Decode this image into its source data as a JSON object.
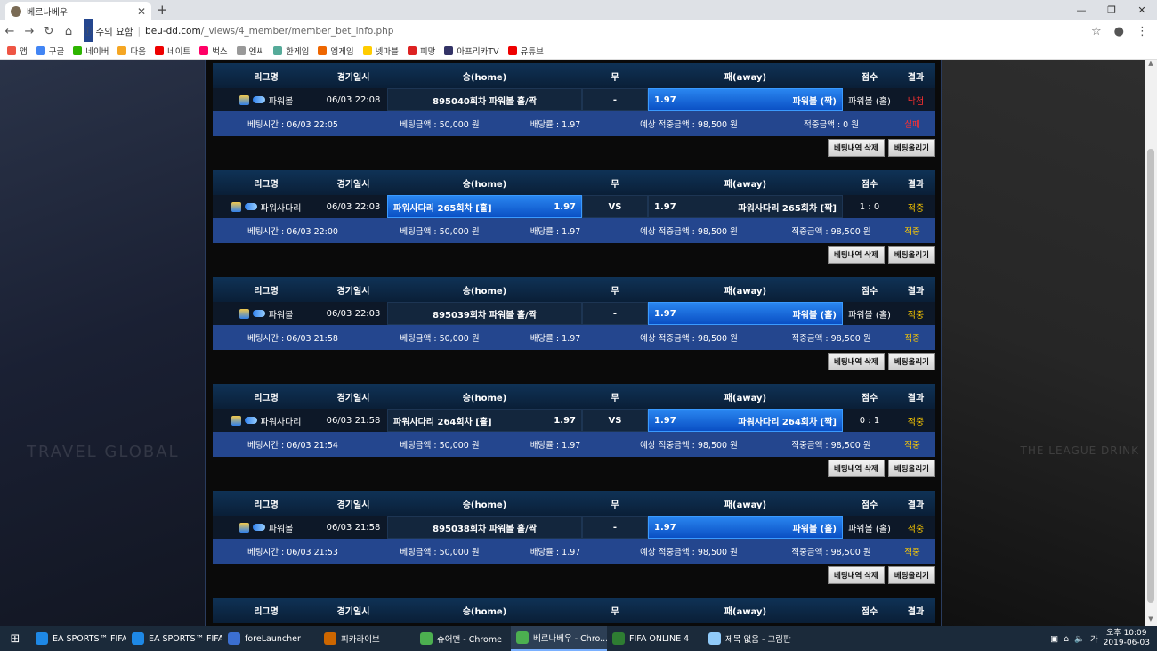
{
  "browser": {
    "tab_title": "베르나베우",
    "url_security": "주의 요함",
    "url_host": "beu-dd.com",
    "url_path": "/_views/4_member/member_bet_info.php"
  },
  "bookmarks": [
    {
      "label": "앱",
      "color": "#e54"
    },
    {
      "label": "구글",
      "color": "#4285f4"
    },
    {
      "label": "네이버",
      "color": "#2db400"
    },
    {
      "label": "다음",
      "color": "#f5a623"
    },
    {
      "label": "네이트",
      "color": "#e00"
    },
    {
      "label": "벅스",
      "color": "#f06"
    },
    {
      "label": "엔씨",
      "color": "#999"
    },
    {
      "label": "한게임",
      "color": "#5a9"
    },
    {
      "label": "엠게임",
      "color": "#e60"
    },
    {
      "label": "넷마블",
      "color": "#fc0"
    },
    {
      "label": "피망",
      "color": "#d22"
    },
    {
      "label": "아프리카TV",
      "color": "#336"
    },
    {
      "label": "유튜브",
      "color": "#e00"
    }
  ],
  "headers": {
    "league": "리그명",
    "date": "경기일시",
    "home": "승(home)",
    "draw": "무",
    "away": "패(away)",
    "score": "점수",
    "result": "결과"
  },
  "buttons": {
    "delete": "베팅내역 삭제",
    "post": "베팅올리기"
  },
  "page_deco": {
    "left": "TRAVEL GLOBAL",
    "right": "THE LEAGUE DRINK"
  },
  "bets": [
    {
      "league": "파워볼",
      "date": "06/03 22:08",
      "home": "895040회차 파워볼 홀/짝",
      "home_odd": "",
      "draw": "-",
      "away": "파워볼 (짝)",
      "away_odd": "1.97",
      "selected": "away",
      "score": "파워볼 (홀)",
      "result": "낙첨",
      "result_class": "lost",
      "bet_time": "베팅시간 : 06/03 22:05",
      "bet_amount": "베팅금액 : 50,000 원",
      "rate": "배당률 : 1.97",
      "expected": "예상 적중금액 : 98,500 원",
      "won": "적중금액 : 0 원",
      "status": "실패",
      "status_class": "lost"
    },
    {
      "league": "파워사다리",
      "date": "06/03 22:03",
      "home": "파워사다리 265회차 [홀]",
      "home_odd": "1.97",
      "draw": "VS",
      "away": "파워사다리 265회차 [짝]",
      "away_odd": "1.97",
      "selected": "home",
      "score": "1 : 0",
      "result": "적중",
      "result_class": "win",
      "bet_time": "베팅시간 : 06/03 22:00",
      "bet_amount": "베팅금액 : 50,000 원",
      "rate": "배당률 : 1.97",
      "expected": "예상 적중금액 : 98,500 원",
      "won": "적중금액 : 98,500 원",
      "status": "적중",
      "status_class": "win"
    },
    {
      "league": "파워볼",
      "date": "06/03 22:03",
      "home": "895039회차 파워볼 홀/짝",
      "home_odd": "",
      "draw": "-",
      "away": "파워볼 (홀)",
      "away_odd": "1.97",
      "selected": "away",
      "score": "파워볼 (홀)",
      "result": "적중",
      "result_class": "win",
      "bet_time": "베팅시간 : 06/03 21:58",
      "bet_amount": "베팅금액 : 50,000 원",
      "rate": "배당률 : 1.97",
      "expected": "예상 적중금액 : 98,500 원",
      "won": "적중금액 : 98,500 원",
      "status": "적중",
      "status_class": "win"
    },
    {
      "league": "파워사다리",
      "date": "06/03 21:58",
      "home": "파워사다리 264회차 [홀]",
      "home_odd": "1.97",
      "draw": "VS",
      "away": "파워사다리 264회차 [짝]",
      "away_odd": "1.97",
      "selected": "away",
      "score": "0 : 1",
      "result": "적중",
      "result_class": "win",
      "bet_time": "베팅시간 : 06/03 21:54",
      "bet_amount": "베팅금액 : 50,000 원",
      "rate": "배당률 : 1.97",
      "expected": "예상 적중금액 : 98,500 원",
      "won": "적중금액 : 98,500 원",
      "status": "적중",
      "status_class": "win"
    },
    {
      "league": "파워볼",
      "date": "06/03 21:58",
      "home": "895038회차 파워볼 홀/짝",
      "home_odd": "",
      "draw": "-",
      "away": "파워볼 (홀)",
      "away_odd": "1.97",
      "selected": "away",
      "score": "파워볼 (홀)",
      "result": "적중",
      "result_class": "win",
      "bet_time": "베팅시간 : 06/03 21:53",
      "bet_amount": "베팅금액 : 50,000 원",
      "rate": "배당률 : 1.97",
      "expected": "예상 적중금액 : 98,500 원",
      "won": "적중금액 : 98,500 원",
      "status": "적중",
      "status_class": "win"
    }
  ],
  "taskbar": {
    "items": [
      {
        "label": "EA SPORTS™ FIFA ...",
        "color": "#1e88e5"
      },
      {
        "label": "EA SPORTS™ FIFA ...",
        "color": "#1e88e5"
      },
      {
        "label": "foreLauncher",
        "color": "#3b6fd1"
      },
      {
        "label": "피카라이브",
        "color": "#c60"
      },
      {
        "label": "슈어맨 - Chrome",
        "color": "#4caf50"
      },
      {
        "label": "베르나베우 - Chro...",
        "color": "#4caf50"
      },
      {
        "label": "FIFA ONLINE 4",
        "color": "#2e7d32"
      },
      {
        "label": "제목 없음 - 그림판",
        "color": "#90caf9"
      }
    ],
    "time": "오후 10:09",
    "date": "2019-06-03"
  }
}
